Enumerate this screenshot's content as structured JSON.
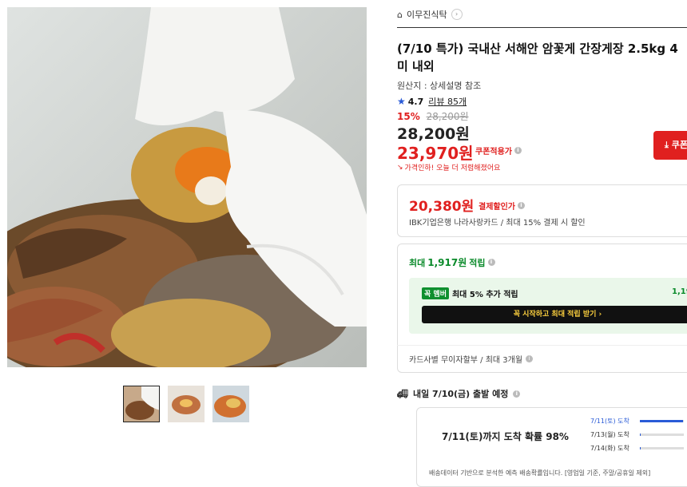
{
  "seller": {
    "name": "이무진식탁",
    "icon": "store-icon"
  },
  "product": {
    "title": "(7/10 특가) 국내산 서해안 암꽃게 간장게장 2.5kg 4미 내외",
    "origin": "원산지 : 상세설명 참조",
    "rating": "4.7",
    "review_link": "리뷰 85개"
  },
  "price": {
    "discount_pct": "15%",
    "original": "28,200원",
    "sale": "28,200원",
    "coupon_price": "23,970원",
    "coupon_label": "쿠폰적용가",
    "notice": "가격인하! 오늘 더 저렴해졌어요",
    "coupon_button": "쿠폰"
  },
  "card_benefit": {
    "price": "20,380원",
    "label": "결제할인가",
    "desc": "IBK기업은행 나라사랑카드 / 최대 15% 결제 시 할인"
  },
  "points": {
    "prefix": "최대",
    "amount": "1,917원",
    "suffix": "적립",
    "member_badge": "꼭 멤버",
    "member_text": "최대 5% 추가 적립",
    "member_amount": "1,19",
    "cta": "꼭 시작하고 최대 적립 받기 ›",
    "installment": "카드사별 무이자할부 / 최대 3개월"
  },
  "shipping": {
    "title": "내일 7/10(금) 출발 예정",
    "arrival_main": "7/11(토)까지 도착 확률 98%",
    "bars": [
      {
        "label": "7/11(토) 도착",
        "fill": 98
      },
      {
        "label": "7/13(월) 도착",
        "fill": 1
      },
      {
        "label": "7/14(화) 도착",
        "fill": 1
      }
    ],
    "footnote": "배송데이터 기반으로 분석한 예측 배송확률입니다. [영업일 기준, 주말/공휴일 제외]"
  },
  "colors": {
    "accent_red": "#e0201f",
    "accent_green": "#0a8a2a",
    "accent_blue": "#2a5bd7"
  }
}
